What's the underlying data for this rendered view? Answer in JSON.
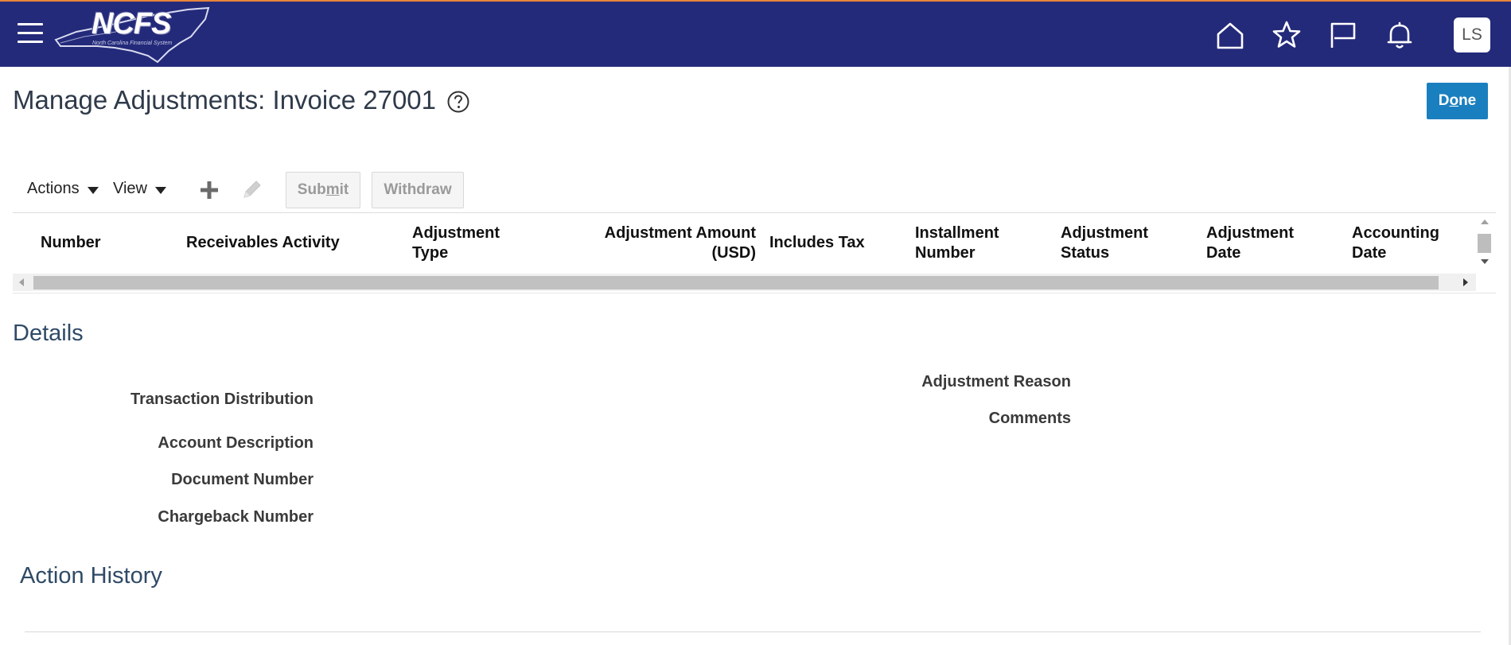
{
  "header": {
    "logo_text": "NCFS",
    "logo_subtitle": "North Carolina Financial System",
    "avatar_initials": "LS",
    "icons": [
      "menu-icon",
      "home-icon",
      "star-icon",
      "flag-icon",
      "bell-icon"
    ],
    "colors": {
      "bar": "#242a7a",
      "accent": "#e8843a"
    }
  },
  "page": {
    "title": "Manage Adjustments: Invoice 27001",
    "done_label_pre": "D",
    "done_label_u": "o",
    "done_label_post": "ne"
  },
  "toolbar": {
    "actions_label": "Actions",
    "view_label": "View",
    "submit_pre": "Sub",
    "submit_u": "m",
    "submit_post": "it",
    "withdraw_label": "Withdraw"
  },
  "table": {
    "columns": [
      [
        "Number"
      ],
      [
        "Receivables Activity"
      ],
      [
        "Adjustment",
        "Type"
      ],
      [
        "Adjustment Amount",
        "(USD)"
      ],
      [
        "Includes Tax"
      ],
      [
        "Installment",
        "Number"
      ],
      [
        "Adjustment",
        "Status"
      ],
      [
        "Adjustment",
        "Date"
      ],
      [
        "Accounting",
        "Date"
      ]
    ]
  },
  "details": {
    "title": "Details",
    "left_labels": [
      "Transaction Distribution",
      "Account Description",
      "Document Number",
      "Chargeback Number"
    ],
    "right_labels": [
      "Adjustment Reason",
      "Comments"
    ]
  },
  "action_history": {
    "title": "Action History"
  }
}
